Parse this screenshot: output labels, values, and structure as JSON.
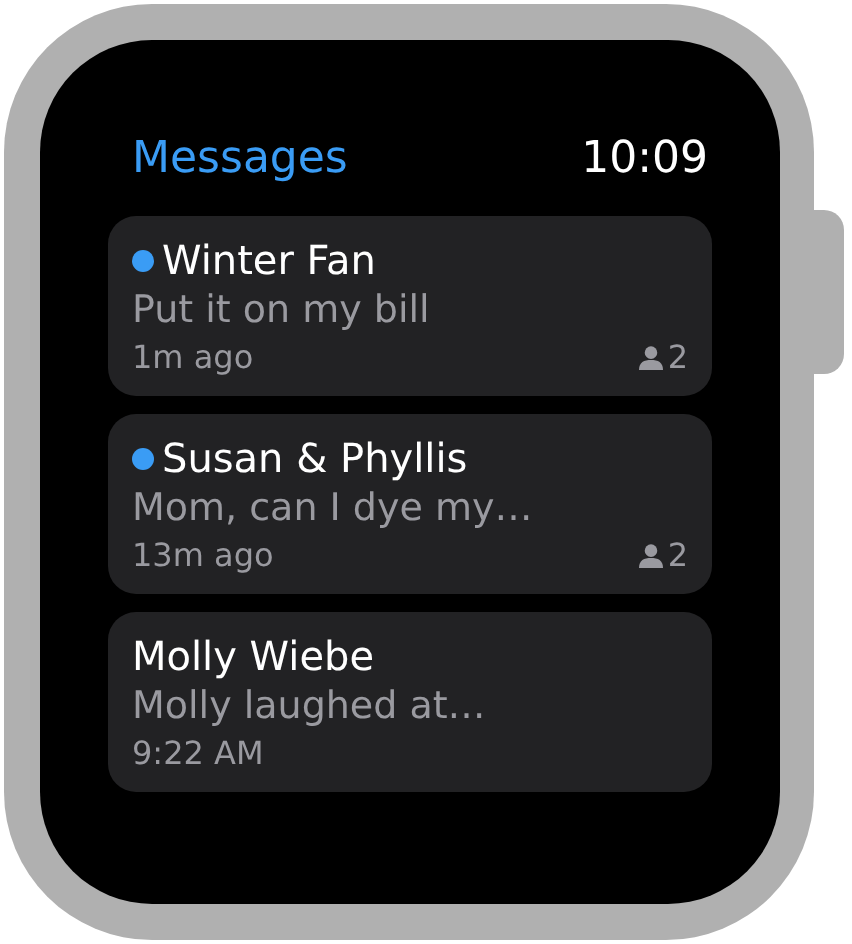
{
  "header": {
    "title": "Messages",
    "time": "10:09"
  },
  "conversations": [
    {
      "name": "Winter Fan",
      "unread": true,
      "preview": "Put it on my bill",
      "time": "1m ago",
      "participants": "2"
    },
    {
      "name": "Susan & Phyllis",
      "unread": true,
      "preview": "Mom, can I dye my…",
      "time": "13m ago",
      "participants": "2"
    },
    {
      "name": "Molly Wiebe",
      "unread": false,
      "preview": "Molly laughed at…",
      "time": "9:22 AM"
    }
  ]
}
